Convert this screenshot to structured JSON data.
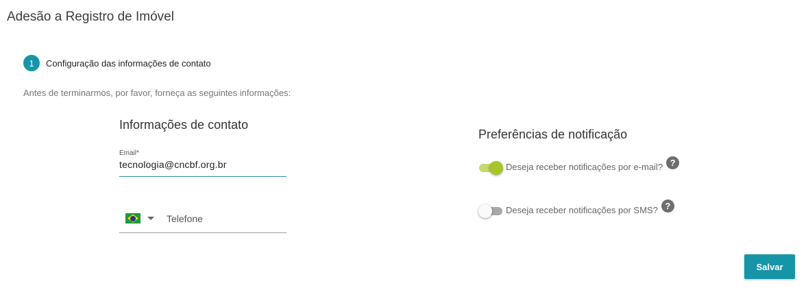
{
  "page": {
    "title": "Adesão a Registro de Imóvel"
  },
  "step": {
    "number": "1",
    "label": "Configuração das informações de contato"
  },
  "intro": "Antes de terminarmos, por favor, forneça as seguintes informações:",
  "contact": {
    "title": "Informações de contato",
    "email": {
      "label": "Email*",
      "value": "tecnologia@cncbf.org.br"
    },
    "phone": {
      "country_flag_icon": "brazil-flag-icon",
      "placeholder": "Telefone"
    }
  },
  "notifications": {
    "title": "Preferências de notificação",
    "email_toggle": {
      "label": "Deseja receber notificações por e-mail?",
      "checked": true,
      "help": "?"
    },
    "sms_toggle": {
      "label": "Deseja receber notificações por SMS?",
      "checked": false,
      "help": "?"
    }
  },
  "actions": {
    "save_label": "Salvar"
  },
  "colors": {
    "accent": "#1695a8",
    "toggle_on": "#a7c52a",
    "help_icon": "#6e6e6e"
  }
}
